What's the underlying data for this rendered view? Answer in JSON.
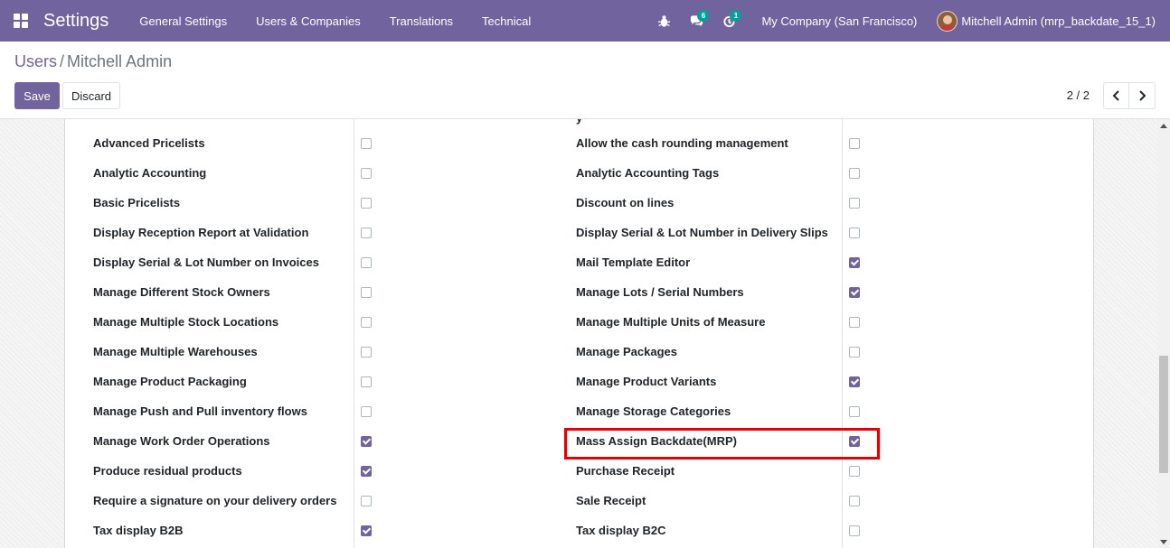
{
  "navbar": {
    "app_name": "Settings",
    "menu": [
      "General Settings",
      "Users & Companies",
      "Translations",
      "Technical"
    ],
    "messages_badge": "6",
    "activity_badge": "1",
    "company": "My Company (San Francisco)",
    "user": "Mitchell Admin (mrp_backdate_15_1)"
  },
  "breadcrumb": {
    "parent": "Users",
    "separator": "/",
    "current": "Mitchell Admin"
  },
  "actions": {
    "save": "Save",
    "discard": "Discard"
  },
  "pager": {
    "value": "2 / 2"
  },
  "colors": {
    "brand": "#71639e",
    "badge": "#00a09d",
    "highlight": "#e60000"
  },
  "left_options": [
    {
      "label": "Advanced Pricelists",
      "checked": false
    },
    {
      "label": "Analytic Accounting",
      "checked": false
    },
    {
      "label": "Basic Pricelists",
      "checked": false
    },
    {
      "label": "Display Reception Report at Validation",
      "checked": false
    },
    {
      "label": "Display Serial & Lot Number on Invoices",
      "checked": false
    },
    {
      "label": "Manage Different Stock Owners",
      "checked": false
    },
    {
      "label": "Manage Multiple Stock Locations",
      "checked": false
    },
    {
      "label": "Manage Multiple Warehouses",
      "checked": false
    },
    {
      "label": "Manage Product Packaging",
      "checked": false
    },
    {
      "label": "Manage Push and Pull inventory flows",
      "checked": false
    },
    {
      "label": "Manage Work Order Operations",
      "checked": true
    },
    {
      "label": "Produce residual products",
      "checked": true
    },
    {
      "label": "Require a signature on your delivery orders",
      "checked": false
    },
    {
      "label": "Tax display B2B",
      "checked": true
    }
  ],
  "right_options": [
    {
      "label": "Allow the cash rounding management",
      "checked": false
    },
    {
      "label": "Analytic Accounting Tags",
      "checked": false
    },
    {
      "label": "Discount on lines",
      "checked": false
    },
    {
      "label": "Display Serial & Lot Number in Delivery Slips",
      "checked": false
    },
    {
      "label": "Mail Template Editor",
      "checked": true
    },
    {
      "label": "Manage Lots / Serial Numbers",
      "checked": true
    },
    {
      "label": "Manage Multiple Units of Measure",
      "checked": false
    },
    {
      "label": "Manage Packages",
      "checked": false
    },
    {
      "label": "Manage Product Variants",
      "checked": true
    },
    {
      "label": "Manage Storage Categories",
      "checked": false
    },
    {
      "label": "Mass Assign Backdate(MRP)",
      "checked": true
    },
    {
      "label": "Purchase Receipt",
      "checked": false
    },
    {
      "label": "Sale Receipt",
      "checked": false
    },
    {
      "label": "Tax display B2C",
      "checked": false
    }
  ]
}
